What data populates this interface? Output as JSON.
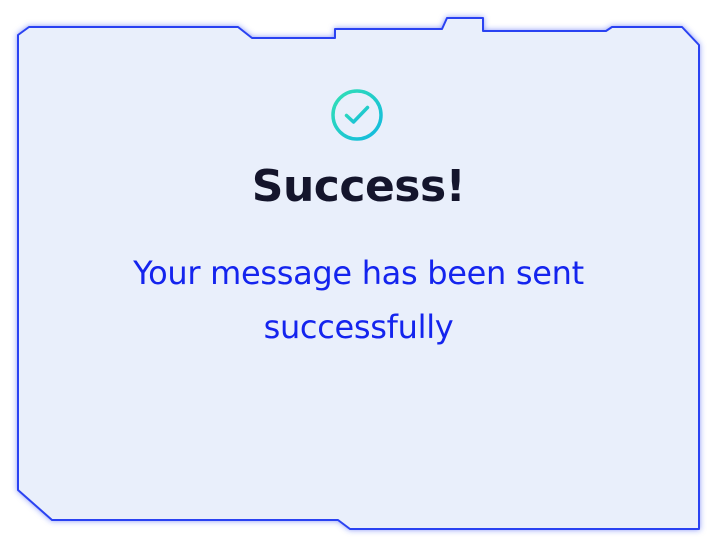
{
  "dialog": {
    "title": "Success!",
    "message": "Your message has been sent successfully",
    "icon": "check-circle-icon"
  },
  "colors": {
    "background": "#e9effb",
    "border": "#2b43f2",
    "title": "#14152c",
    "message": "#1424ee",
    "icon": "#1fd0c0"
  }
}
